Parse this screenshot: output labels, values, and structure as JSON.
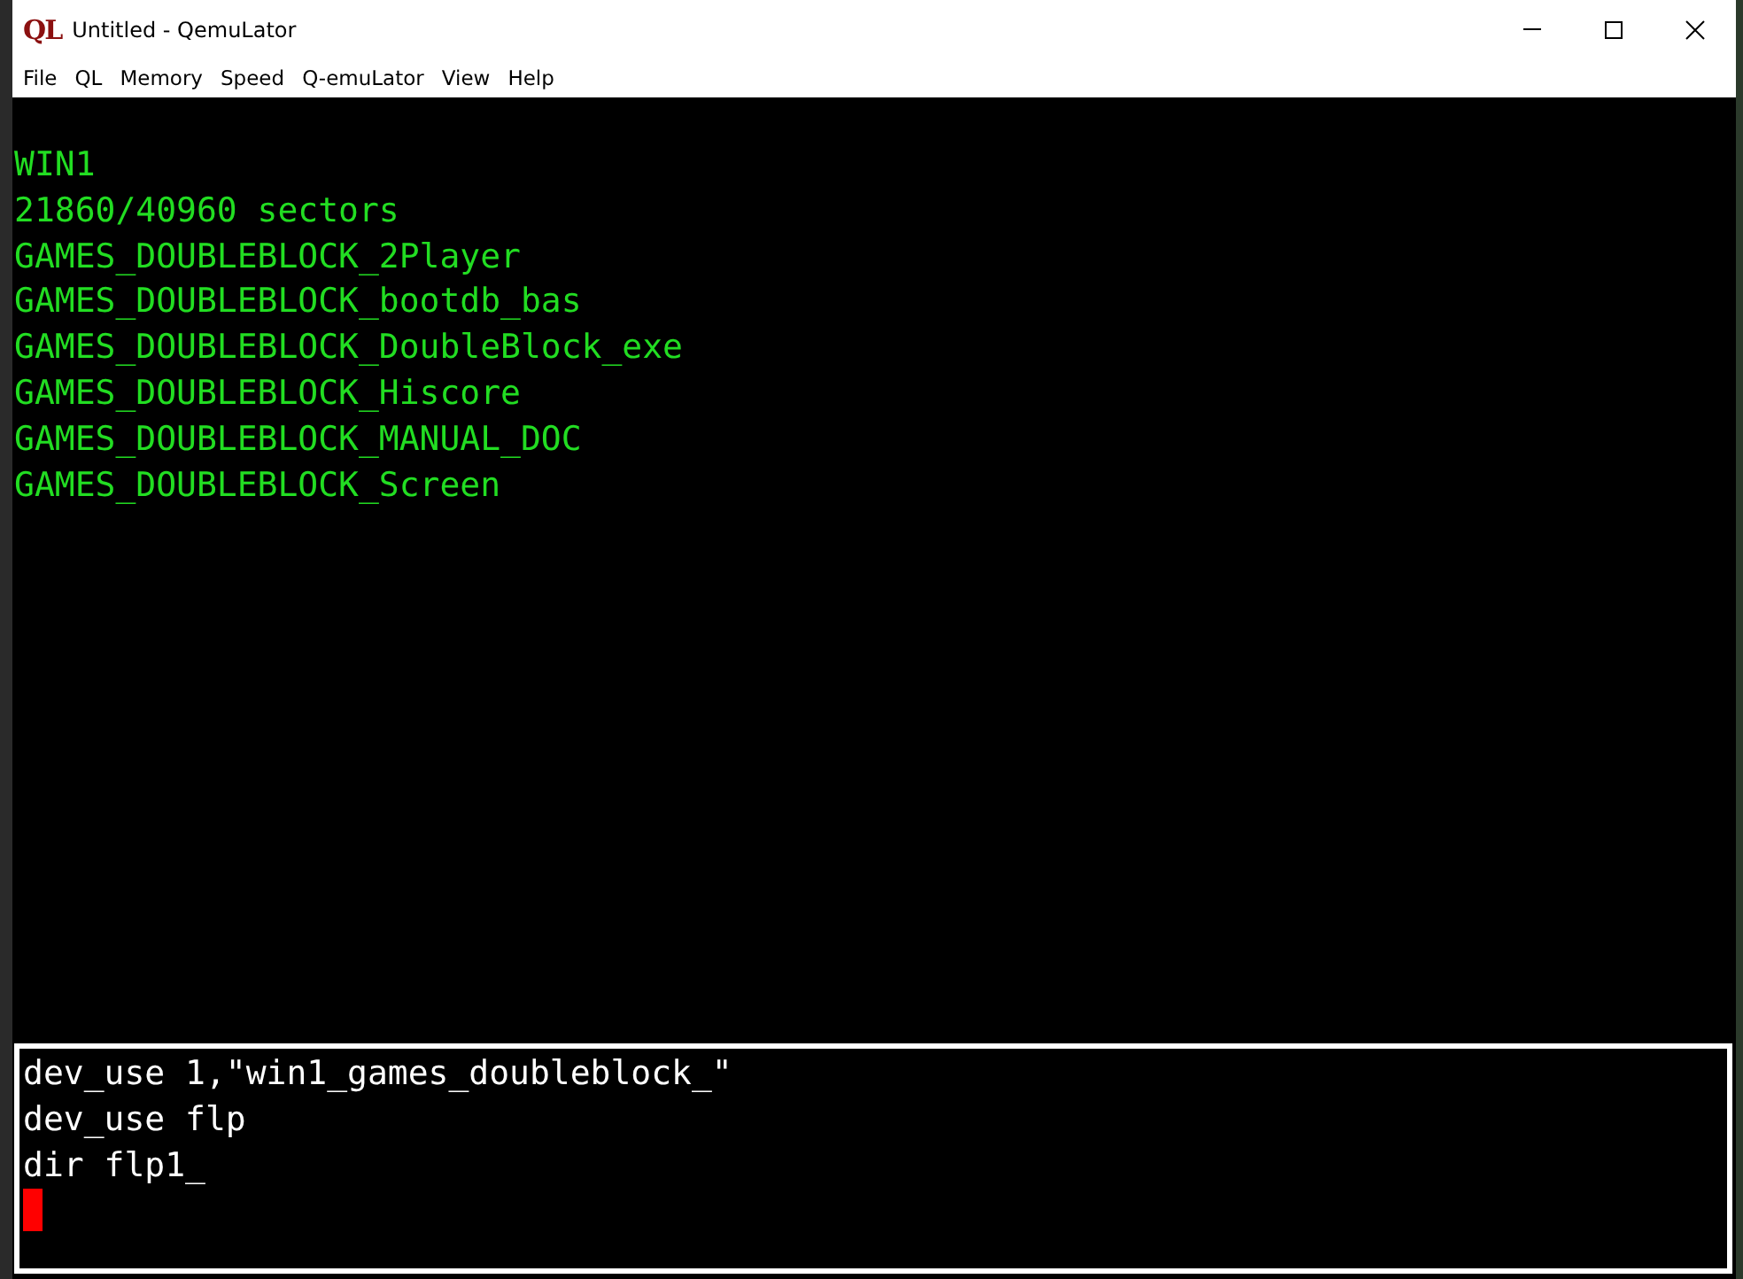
{
  "window": {
    "logo": "QL",
    "title": "Untitled - QemuLator"
  },
  "menu": [
    "File",
    "QL",
    "Memory",
    "Speed",
    "Q-emuLator",
    "View",
    "Help"
  ],
  "screen_output": [
    "WIN1",
    "21860/40960 sectors",
    "GAMES_DOUBLEBLOCK_2Player",
    "GAMES_DOUBLEBLOCK_bootdb_bas",
    "GAMES_DOUBLEBLOCK_DoubleBlock_exe",
    "GAMES_DOUBLEBLOCK_Hiscore",
    "GAMES_DOUBLEBLOCK_MANUAL_DOC",
    "GAMES_DOUBLEBLOCK_Screen"
  ],
  "command_window": {
    "lines": [
      "dev_use 1,\"win1_games_doubleblock_\"",
      "dev_use flp",
      "dir flp1_"
    ]
  }
}
